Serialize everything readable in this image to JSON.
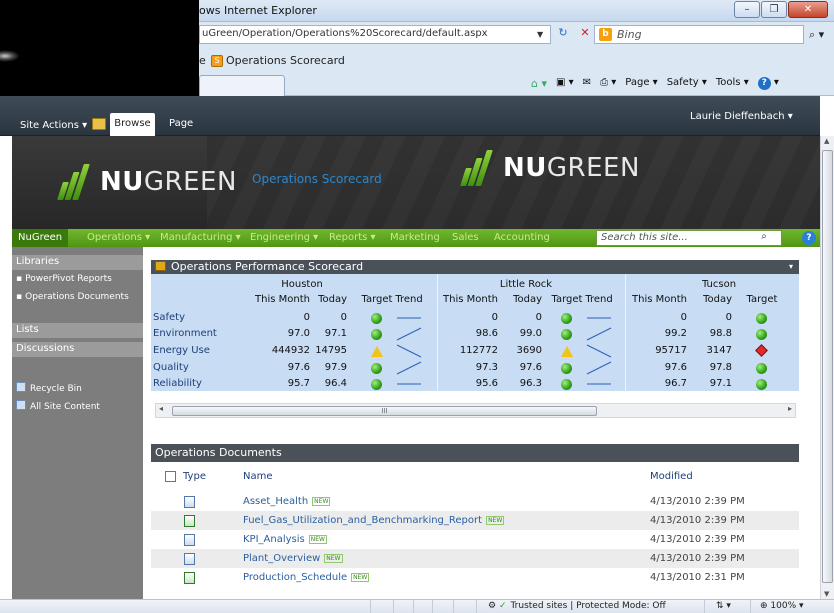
{
  "browser": {
    "window_title": "ows Internet Explorer",
    "url": "uGreen/Operation/Operations%20Scorecard/default.aspx",
    "search_placeholder": "Bing",
    "fav_prefix": "e",
    "tab_title": "Operations Scorecard",
    "commands": [
      "Page ▾",
      "Safety ▾",
      "Tools ▾"
    ],
    "status": {
      "zone": "Trusted sites | Protected Mode: Off",
      "zoom": "100%"
    }
  },
  "ribbon": {
    "site_actions": "Site Actions ▾",
    "tabs": [
      "Browse",
      "Page"
    ],
    "user": "Laurie Dieffenbach ▾"
  },
  "banner": {
    "brand_bold": "NU",
    "brand_light": "GREEN",
    "site_title": "Operations Scorecard"
  },
  "topnav": {
    "home": "NuGreen",
    "items": [
      "Operations ▾",
      "Manufacturing ▾",
      "Engineering ▾",
      "Reports ▾",
      "Marketing",
      "Sales",
      "Accounting"
    ],
    "search_placeholder": "Search this site..."
  },
  "quicklaunch": {
    "libraries_heading": "Libraries",
    "libraries": [
      "PowerPivot Reports",
      "Operations Documents"
    ],
    "lists_heading": "Lists",
    "discussions_heading": "Discussions",
    "recycle_bin": "Recycle Bin",
    "all_site_content": "All Site Content"
  },
  "scorecard": {
    "title": "Operations Performance Scorecard",
    "locations": [
      "Houston",
      "Little Rock",
      "Tucson"
    ],
    "columns": [
      "This Month",
      "Today",
      "Target",
      "Trend"
    ],
    "rows": [
      {
        "label": "Safety",
        "values": [
          [
            "0",
            "0"
          ],
          [
            "0",
            "0"
          ],
          [
            "0",
            "0"
          ]
        ],
        "targets": [
          "green",
          "green",
          "green"
        ],
        "trends": [
          "flat",
          "flat"
        ]
      },
      {
        "label": "Environment",
        "values": [
          [
            "97.0",
            "97.1"
          ],
          [
            "98.6",
            "99.0"
          ],
          [
            "99.2",
            "98.8"
          ]
        ],
        "targets": [
          "green",
          "green",
          "green"
        ],
        "trends": [
          "up",
          "up"
        ]
      },
      {
        "label": "Energy Use",
        "values": [
          [
            "444932",
            "14795"
          ],
          [
            "112772",
            "3690"
          ],
          [
            "95717",
            "3147"
          ]
        ],
        "targets": [
          "yellow",
          "yellow",
          "red"
        ],
        "trends": [
          "down",
          "down"
        ]
      },
      {
        "label": "Quality",
        "values": [
          [
            "97.6",
            "97.9"
          ],
          [
            "97.3",
            "97.6"
          ],
          [
            "97.6",
            "97.8"
          ]
        ],
        "targets": [
          "green",
          "green",
          "green"
        ],
        "trends": [
          "up",
          "up"
        ]
      },
      {
        "label": "Reliability",
        "values": [
          [
            "95.7",
            "96.4"
          ],
          [
            "95.6",
            "96.3"
          ],
          [
            "96.7",
            "97.1"
          ]
        ],
        "targets": [
          "green",
          "green",
          "green"
        ],
        "trends": [
          "flat",
          "flat"
        ]
      }
    ],
    "scroll_grip": "III"
  },
  "documents": {
    "title": "Operations Documents",
    "headers": {
      "type": "Type",
      "name": "Name",
      "modified": "Modified"
    },
    "new_tag": "NEW",
    "rows": [
      {
        "name": "Asset_Health",
        "modified": "4/13/2010 2:39 PM",
        "icon": "doc"
      },
      {
        "name": "Fuel_Gas_Utilization_and_Benchmarking_Report",
        "modified": "4/13/2010 2:39 PM",
        "icon": "xls"
      },
      {
        "name": "KPI_Analysis",
        "modified": "4/13/2010 2:39 PM",
        "icon": "doc"
      },
      {
        "name": "Plant_Overview",
        "modified": "4/13/2010 2:39 PM",
        "icon": "doc"
      },
      {
        "name": "Production_Schedule",
        "modified": "4/13/2010 2:31 PM",
        "icon": "xls"
      }
    ]
  },
  "colors": {
    "accent_green": "#5aa21d",
    "header_dark": "#4b5158",
    "link_blue": "#2a5fa0",
    "scorecard_bg": "#c8dcf3"
  }
}
